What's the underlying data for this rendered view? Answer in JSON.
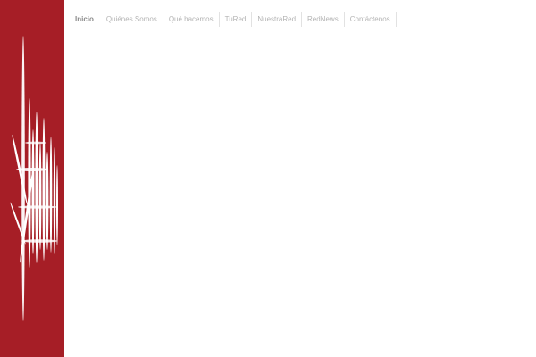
{
  "nav": {
    "items": [
      {
        "label": "Inicio",
        "active": true
      },
      {
        "label": "Quiénes Somos",
        "active": false
      },
      {
        "label": "Qué hacemos",
        "active": false
      },
      {
        "label": "TuRed",
        "active": false
      },
      {
        "label": "NuestraRed",
        "active": false
      },
      {
        "label": "RedNews",
        "active": false
      },
      {
        "label": "Contáctenos",
        "active": false
      }
    ]
  },
  "brand": {
    "panel_color": "#a61e26",
    "accent_color": "#ffffff"
  }
}
